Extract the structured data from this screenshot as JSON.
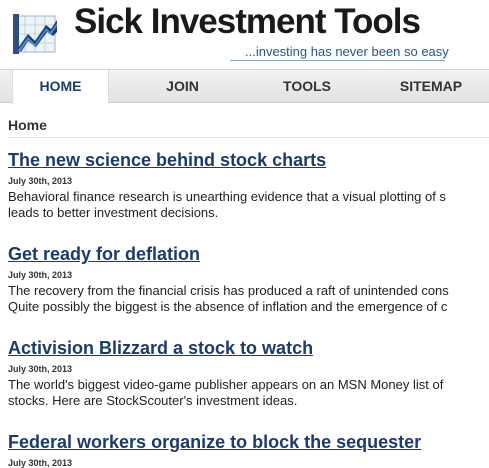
{
  "header": {
    "title": "Sick Investment Tools",
    "tagline": "...investing has never been so easy"
  },
  "nav": {
    "items": [
      {
        "label": "HOME",
        "active": true
      },
      {
        "label": "JOIN",
        "active": false
      },
      {
        "label": "TOOLS",
        "active": false
      },
      {
        "label": "SITEMAP",
        "active": false
      }
    ]
  },
  "breadcrumb": "Home",
  "articles": [
    {
      "title": "The new science behind stock charts",
      "date": "July 30th, 2013",
      "summary_lines": [
        "Behavioral finance research is unearthing evidence that a visual plotting of s",
        "leads to better investment decisions."
      ]
    },
    {
      "title": "Get ready for deflation",
      "date": "July 30th, 2013",
      "summary_lines": [
        "The recovery from the financial crisis has produced a raft of unintended cons",
        "Quite possibly the biggest is the absence of inflation and the emergence of c"
      ]
    },
    {
      "title": "Activision Blizzard a stock to watch",
      "date": "July 30th, 2013",
      "summary_lines": [
        "The world's biggest video-game publisher appears on an MSN Money list of",
        "stocks. Here are StockScouter's investment ideas."
      ]
    },
    {
      "title": "Federal workers organize to block the sequester",
      "date": "July 30th, 2013",
      "summary_lines": []
    }
  ],
  "colors": {
    "link": "#1b3a6e",
    "tagline": "#24568f",
    "nav_active": "#1d3c70"
  }
}
